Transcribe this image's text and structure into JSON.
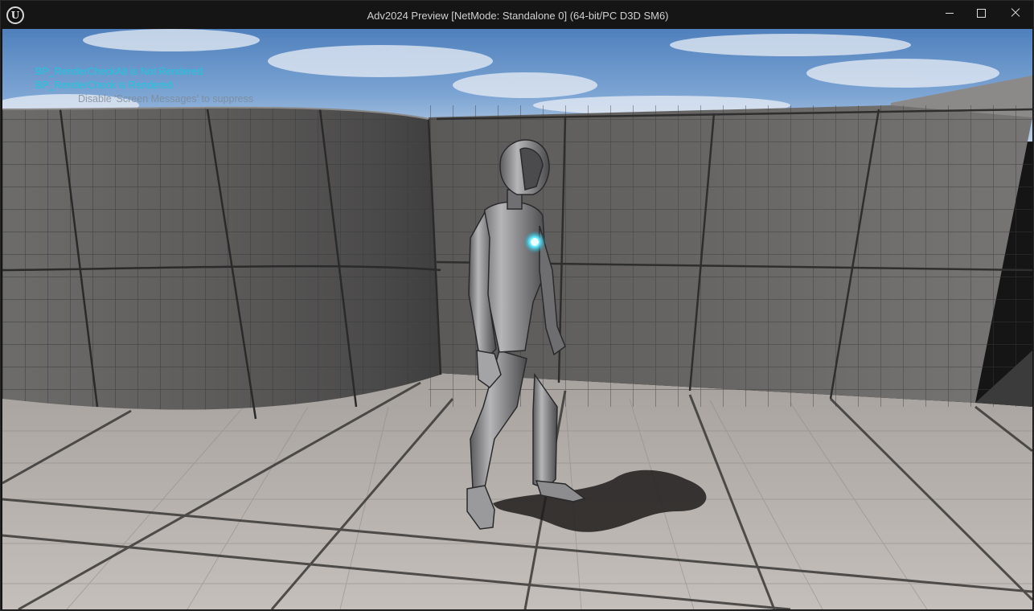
{
  "window": {
    "title": "Adv2024 Preview [NetMode: Standalone 0]  (64-bit/PC D3D SM6)",
    "app_icon": "unreal-engine-logo",
    "app_icon_glyph": "U",
    "controls": {
      "minimize": "minimize-icon",
      "maximize": "maximize-icon",
      "close": "close-icon"
    }
  },
  "debug_messages": [
    "BP_RenderCheckAlt is Not Rendered",
    "BP_RenderCheck is Rendered",
    "Disable 'Screen Messages' to suppress"
  ],
  "colors": {
    "debug_text": "#1fc6dc",
    "hint_text": "#7d8690",
    "chest_light": "#5fe8ff"
  }
}
